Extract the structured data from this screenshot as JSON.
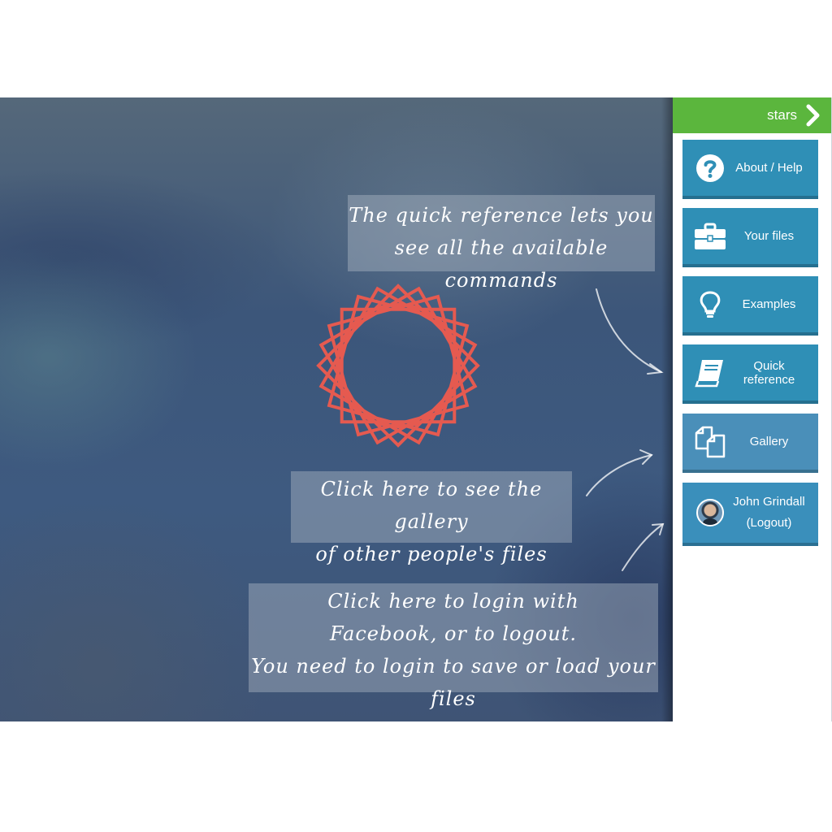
{
  "panel": {
    "title": "stars",
    "header_color": "#5bb63d",
    "items": [
      {
        "label": "About / Help",
        "icon": "question-circle-icon"
      },
      {
        "label": "Your files",
        "icon": "briefcase-icon"
      },
      {
        "label": "Examples",
        "icon": "lightbulb-icon"
      },
      {
        "label": "Quick reference",
        "icon": "book-icon"
      },
      {
        "label": "Gallery",
        "icon": "copy-documents-icon"
      }
    ],
    "user": {
      "name": "John Grindall",
      "action": "(Logout)",
      "icon": "avatar"
    },
    "button_color": "#2f8fb6"
  },
  "tips": {
    "quickref": {
      "line1": "The quick reference lets you",
      "line2": "see all the available commands"
    },
    "gallery": {
      "line1": "Click here to see the gallery",
      "line2": "of other people's files"
    },
    "login": {
      "line1": "Click here to login with",
      "line2": "Facebook, or to logout.",
      "line3": "You need to login to save or load your files"
    }
  },
  "drawing": {
    "color": "#e55a50",
    "shape": "stars"
  }
}
